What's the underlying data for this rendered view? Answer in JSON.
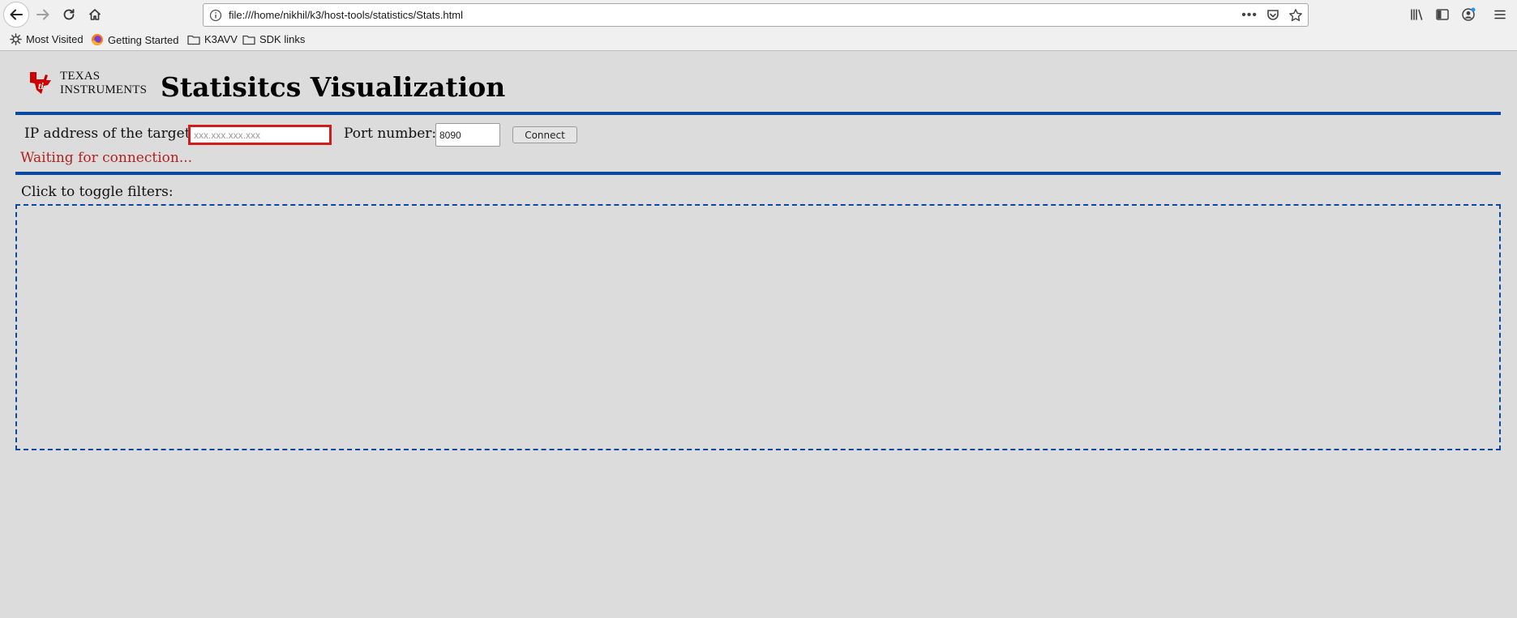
{
  "browser": {
    "url": "file:///home/nikhil/k3/host-tools/statistics/Stats.html",
    "nav_icons": [
      "back-arrow-icon",
      "forward-arrow-icon",
      "reload-icon",
      "home-icon"
    ],
    "bookmarks": [
      {
        "label": "Most Visited",
        "icon": "gear-icon"
      },
      {
        "label": "Getting Started",
        "icon": "firefox-icon"
      },
      {
        "label": "K3AVV",
        "icon": "folder-icon"
      },
      {
        "label": "SDK links",
        "icon": "folder-icon"
      }
    ]
  },
  "page": {
    "logo_line1": "Texas",
    "logo_line2": "Instruments",
    "title": "Statisitcs Visualization",
    "ip_label": "IP address of the target:",
    "ip_placeholder": "xxx.xxx.xxx.xxx",
    "ip_value": "",
    "port_label": "Port number:",
    "port_value": "8090",
    "connect_label": "Connect",
    "status": "Waiting for connection...",
    "filters_label": "Click to toggle filters:"
  },
  "colors": {
    "rule": "#0a4a9e",
    "status": "#b22222",
    "ti_red": "#cc0000",
    "input_error_border": "#d01c1c",
    "page_background": "#dcdcdc"
  }
}
